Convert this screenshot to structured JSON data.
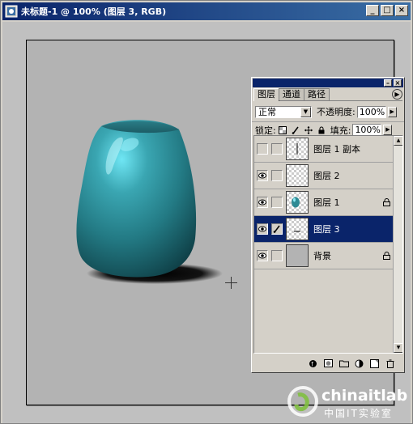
{
  "document": {
    "title": "未标题-1 @ 100% (图层 3, RGB)",
    "window_buttons": [
      "_",
      "□",
      "×"
    ]
  },
  "layers_palette": {
    "tabs": [
      {
        "label": "图层",
        "active": true
      },
      {
        "label": "通道",
        "active": false
      },
      {
        "label": "路径",
        "active": false
      }
    ],
    "blend_mode": "正常",
    "opacity_label": "不透明度:",
    "opacity_value": "100%",
    "lock_label": "锁定:",
    "fill_label": "填充:",
    "fill_value": "100%",
    "layers": [
      {
        "name": "图层 1 副本",
        "visible": false,
        "selected": false,
        "thumb": "line",
        "locked": false
      },
      {
        "name": "图层 2",
        "visible": true,
        "selected": false,
        "thumb": "empty",
        "locked": false
      },
      {
        "name": "图层 1",
        "visible": true,
        "selected": false,
        "thumb": "vase",
        "locked": true
      },
      {
        "name": "图层 3",
        "visible": true,
        "selected": true,
        "thumb": "dash",
        "locked": false
      },
      {
        "name": "背景",
        "visible": true,
        "selected": false,
        "thumb": "gray",
        "locked": true
      }
    ]
  },
  "watermark": {
    "text": "chinaitlab",
    "subtext": "中国IT实验室"
  },
  "colors": {
    "title_bar": "#0a246a",
    "selection": "#0a246a",
    "vase": "#2e8a94"
  }
}
